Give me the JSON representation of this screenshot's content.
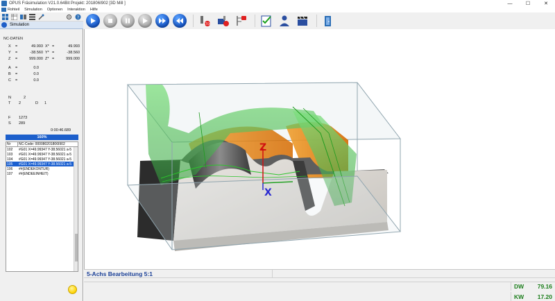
{
  "window": {
    "title": "OPUS Fräsimulation V21.0.64Bit  Projekt: 201806I902        [3D Mill ]",
    "controls": {
      "minimize": "—",
      "maximize": "☐",
      "close": "✕"
    }
  },
  "menu": [
    "Rohteil",
    "Simulation",
    "Optionen",
    "Interaktion",
    "Hilfe"
  ],
  "sidebar": {
    "tab_label": "Simulation",
    "nc_title": "NC-DATEN",
    "coords": [
      {
        "k": "X",
        "s": "=",
        "v": "49.993",
        "k2": "X*",
        "s2": "=",
        "v2": "49.993"
      },
      {
        "k": "Y",
        "s": "=",
        "v": "-38.560",
        "k2": "Y*",
        "s2": "=",
        "v2": "-38.560"
      },
      {
        "k": "Z",
        "s": "=",
        "v": "999.000",
        "k2": "Z*",
        "s2": "=",
        "v2": "999.000"
      }
    ],
    "angles": [
      {
        "k": "A",
        "s": "=",
        "v": "0.0"
      },
      {
        "k": "B",
        "s": "=",
        "v": "0.0"
      },
      {
        "k": "C",
        "s": "=",
        "v": "0.0"
      }
    ],
    "n_label": "N",
    "n_value": "2",
    "t_label": "T",
    "t_value": "2",
    "d_label": "D",
    "d_value": "1",
    "f_label": "F",
    "f_value": "1273",
    "s_label": "S",
    "s_value": "289",
    "time": "0:00:46.689",
    "progress_label": "160%",
    "progress": 1.0,
    "table": {
      "col_nr": "Nr",
      "col_code": "NC-Code: 000080201806I902",
      "rows": [
        {
          "nr": "102",
          "code": "#G01 X=49.99347 Y-38.56021 a-5",
          "selected": false
        },
        {
          "nr": "103",
          "code": "#G01 X=49.99347 Y-38.56021 a-5",
          "selected": false
        },
        {
          "nr": "104",
          "code": "#G01 X=49.99347 Y-38.56021 a-5",
          "selected": false
        },
        {
          "nr": "105",
          "code": "#G01 X=49.99347 Y-38.56021 a-5",
          "selected": true
        },
        {
          "nr": "106",
          "code": "##(ENDEKONTUR)",
          "selected": false
        },
        {
          "nr": "107",
          "code": "##(ENDEEINHEIT)",
          "selected": false
        }
      ]
    }
  },
  "toolbar": {
    "playback": [
      {
        "name": "play-button",
        "state": "on"
      },
      {
        "name": "stop-button",
        "state": "off"
      },
      {
        "name": "pause-button",
        "state": "off"
      },
      {
        "name": "step-button",
        "state": "off"
      },
      {
        "name": "fast-forward-button",
        "state": "on"
      },
      {
        "name": "rewind-button",
        "state": "on"
      }
    ]
  },
  "axes": {
    "x": "X",
    "z": "Z"
  },
  "status": {
    "operation": "5-Achs Bearbeitung 5:1",
    "dw_label": "DW",
    "dw_value": "79.16",
    "kw_label": "KW",
    "kw_value": "17.20"
  },
  "colors": {
    "accent": "#1554c4",
    "status_green": "#1b7d1b",
    "status_blue": "#1a3f96",
    "axis_x": "#2a2ad0",
    "axis_z": "#d01010",
    "axis_y": "#20a020"
  }
}
